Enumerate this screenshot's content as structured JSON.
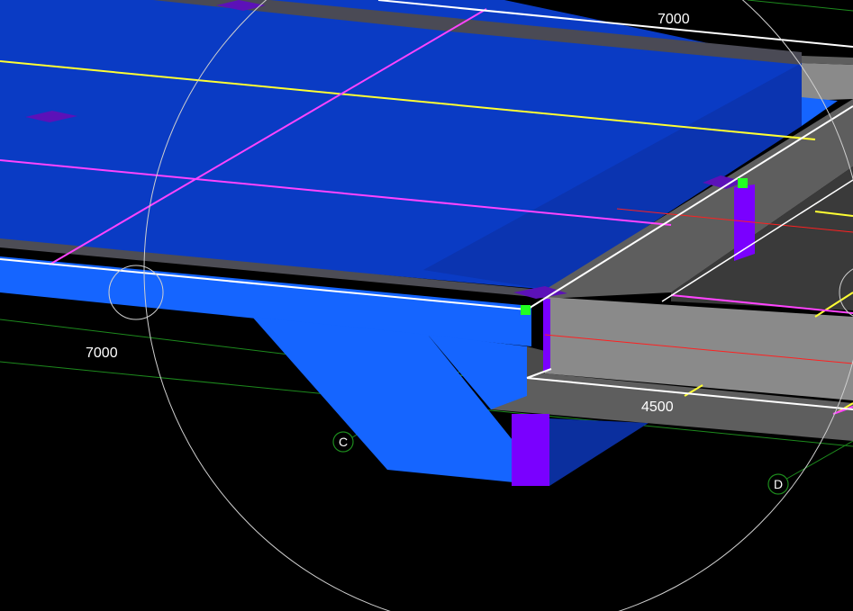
{
  "viewport": {
    "background": "#000000"
  },
  "colors": {
    "slab_top": "#0a3bc4",
    "slab_edge": "#1565ff",
    "slab_dark": "#0b2f9e",
    "concrete_top": "#5e5e5e",
    "concrete_side": "#8a8a8a",
    "concrete_dark": "#3a3a3a",
    "column": "#7a00ff",
    "magenta_line": "#ff44ff",
    "yellow_line": "#ffff33",
    "red_line": "#ff2020",
    "green_line": "#1d8a1d",
    "white_line": "#ffffff",
    "snap_point": "#22ff22",
    "orbit_circle": "#cfcfcf"
  },
  "dimensions": [
    {
      "id": "dim-top-right",
      "text": "7000"
    },
    {
      "id": "dim-left",
      "text": "7000"
    },
    {
      "id": "dim-bottom",
      "text": "4500"
    }
  ],
  "grid_bubbles": [
    {
      "id": "grid-c",
      "label": "C"
    },
    {
      "id": "grid-d",
      "label": "D"
    }
  ]
}
